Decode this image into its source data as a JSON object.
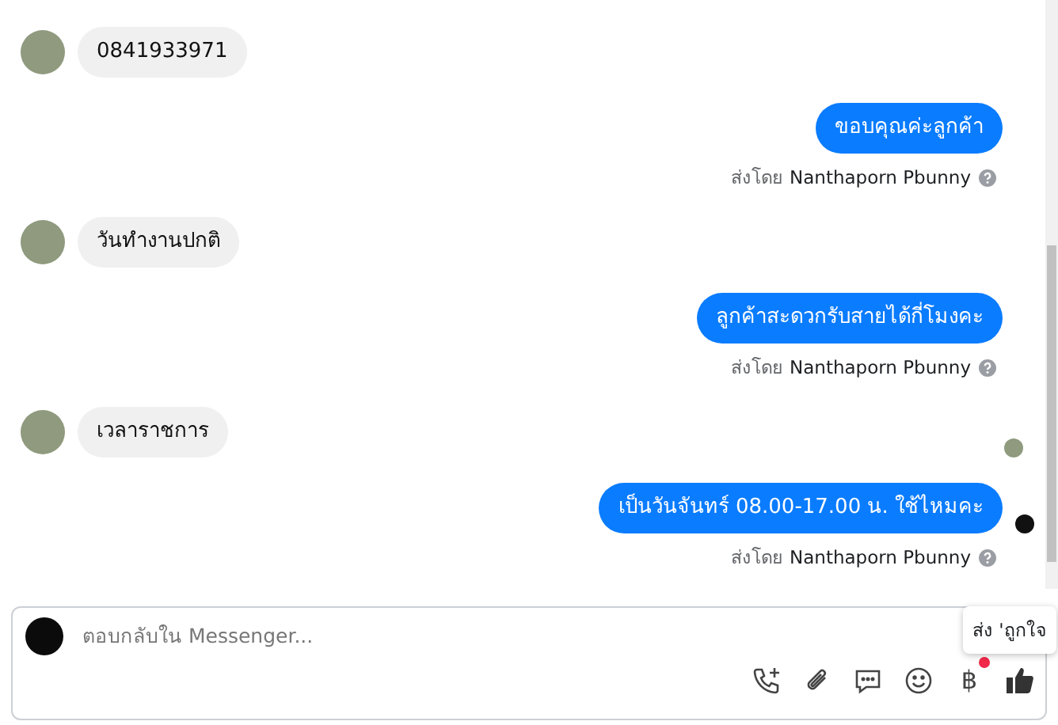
{
  "messages": [
    {
      "kind": "incoming",
      "text": "0841933971"
    },
    {
      "kind": "outgoing",
      "text": "ขอบคุณค่ะลูกค้า",
      "sent_by_label": "ส่งโดย",
      "sender": "Nanthaporn Pbunny"
    },
    {
      "kind": "incoming",
      "text": "วันทำงานปกติ"
    },
    {
      "kind": "outgoing",
      "text": "ลูกค้าสะดวกรับสายได้กี่โมงคะ",
      "sent_by_label": "ส่งโดย",
      "sender": "Nanthaporn Pbunny"
    },
    {
      "kind": "incoming",
      "text": "เวลาราชการ",
      "seen_by_customer": true
    },
    {
      "kind": "outgoing",
      "text": "เป็นวันจันทร์ 08.00-17.00 น. ใช้ไหมคะ",
      "sent_by_label": "ส่งโดย",
      "sender": "Nanthaporn Pbunny",
      "seen_by_page": true
    }
  ],
  "composer": {
    "placeholder": "ตอบกลับใน Messenger...",
    "payment_symbol": "฿",
    "payment_notification": true
  },
  "tooltip": {
    "text": "ส่ง 'ถูกใจ"
  }
}
